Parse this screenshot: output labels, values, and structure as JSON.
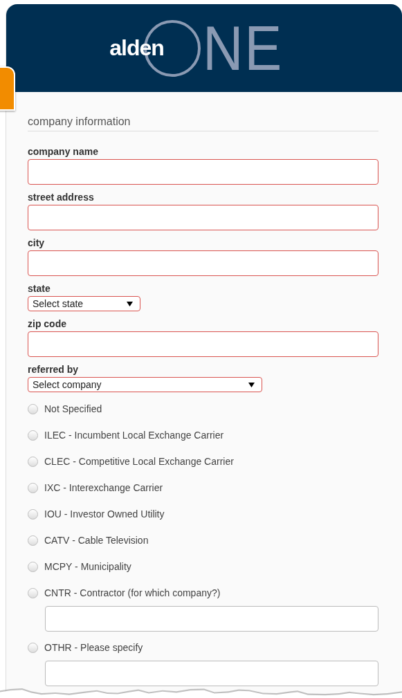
{
  "logo": {
    "word": "alden",
    "suffix": "NE"
  },
  "section_title": "company information",
  "fields": [
    {
      "kind": "text",
      "label": "company name",
      "invalid": true
    },
    {
      "kind": "text",
      "label": "street address",
      "invalid": true
    },
    {
      "kind": "text",
      "label": "city",
      "invalid": true
    },
    {
      "kind": "short-select",
      "label": "state",
      "value": "Select state",
      "invalid": true
    },
    {
      "kind": "text",
      "label": "zip code",
      "invalid": true
    },
    {
      "kind": "long-select",
      "label": "referred by",
      "value": "Select company",
      "invalid": true
    }
  ],
  "radios": [
    {
      "kind": "plain",
      "label": "Not Specified",
      "selected": false
    },
    {
      "kind": "plain",
      "label": "ILEC - Incumbent Local Exchange Carrier",
      "selected": false
    },
    {
      "kind": "plain",
      "label": "CLEC - Competitive Local Exchange Carrier",
      "selected": false
    },
    {
      "kind": "plain",
      "label": "IXC - Interexchange Carrier",
      "selected": false
    },
    {
      "kind": "plain",
      "label": "IOU - Investor Owned Utility",
      "selected": false
    },
    {
      "kind": "plain",
      "label": "CATV - Cable Television",
      "selected": false
    },
    {
      "kind": "plain",
      "label": "MCPY - Municipality",
      "selected": false
    },
    {
      "kind": "with-input",
      "label": "CNTR - Contractor (for which company?)",
      "selected": false
    },
    {
      "kind": "with-input",
      "label": "OTHR - Please specify",
      "selected": false
    }
  ]
}
